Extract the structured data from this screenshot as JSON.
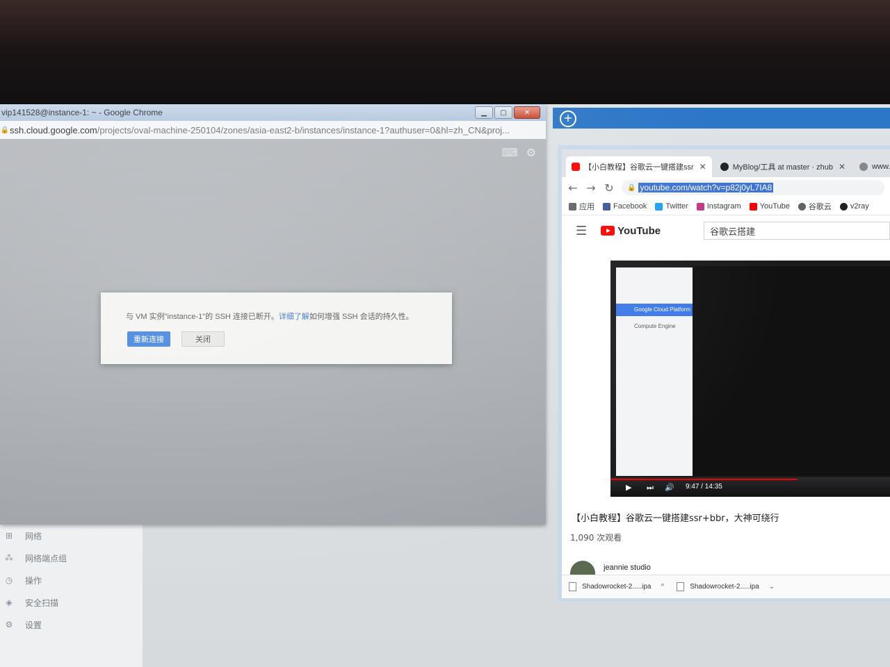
{
  "left_window": {
    "title": "vip141528@instance-1: ~ - Google Chrome",
    "url_host": "ssh.cloud.google.com",
    "url_path": "/projects/oval-machine-250104/zones/asia-east2-b/instances/instance-1?authuser=0&hl=zh_CN&proj...",
    "dialog": {
      "message_pre": "与 VM 实例\"instance-1\"的 SSH 连接已断开。",
      "link": "详细了解",
      "message_post": "如何增强 SSH 会话的持久性。",
      "reconnect": "重新连接",
      "close": "关闭"
    }
  },
  "gcp_sidebar": {
    "items": [
      {
        "label": "网络",
        "icon": "grid-icon"
      },
      {
        "label": "网络端点组",
        "icon": "nodes-icon"
      },
      {
        "label": "操作",
        "icon": "clock-icon"
      },
      {
        "label": "安全扫描",
        "icon": "shield-icon"
      },
      {
        "label": "设置",
        "icon": "gear-icon"
      }
    ]
  },
  "right_window": {
    "tabs": [
      {
        "label": "【小白教程】谷歌云一键搭建ssr",
        "icon": "youtube-icon"
      },
      {
        "label": "MyBlog/工具 at master · zhub",
        "icon": "github-icon"
      },
      {
        "label": "www.you",
        "icon": "globe-icon"
      }
    ],
    "url": "youtube.com/watch?v=p82j0yL7IA8",
    "bookmarks": [
      {
        "label": "应用",
        "color": "#5f6368"
      },
      {
        "label": "Facebook",
        "color": "#3b5998"
      },
      {
        "label": "Twitter",
        "color": "#1da1f2"
      },
      {
        "label": "Instagram",
        "color": "#c13584"
      },
      {
        "label": "YouTube",
        "color": "#ff0000"
      },
      {
        "label": "谷歌云",
        "color": "#5f6368"
      },
      {
        "label": "v2ray",
        "color": "#222222"
      }
    ],
    "youtube": {
      "logo": "YouTube",
      "search_value": "谷歌云搭建",
      "video_time": "9:47 / 14:35",
      "video_progress": 0.67,
      "video_inner": {
        "gcp_header": "Google Cloud Platform",
        "compute_engine": "Compute Engine"
      },
      "video_title": "【小白教程】谷歌云一键搭建ssr+bbr，大神可绕行",
      "views": "1,090 次观看",
      "channel": "jeannie studio"
    },
    "downloads": [
      {
        "name": "Shadowrocket-2.....ipa"
      },
      {
        "name": "Shadowrocket-2.....ipa"
      }
    ]
  }
}
